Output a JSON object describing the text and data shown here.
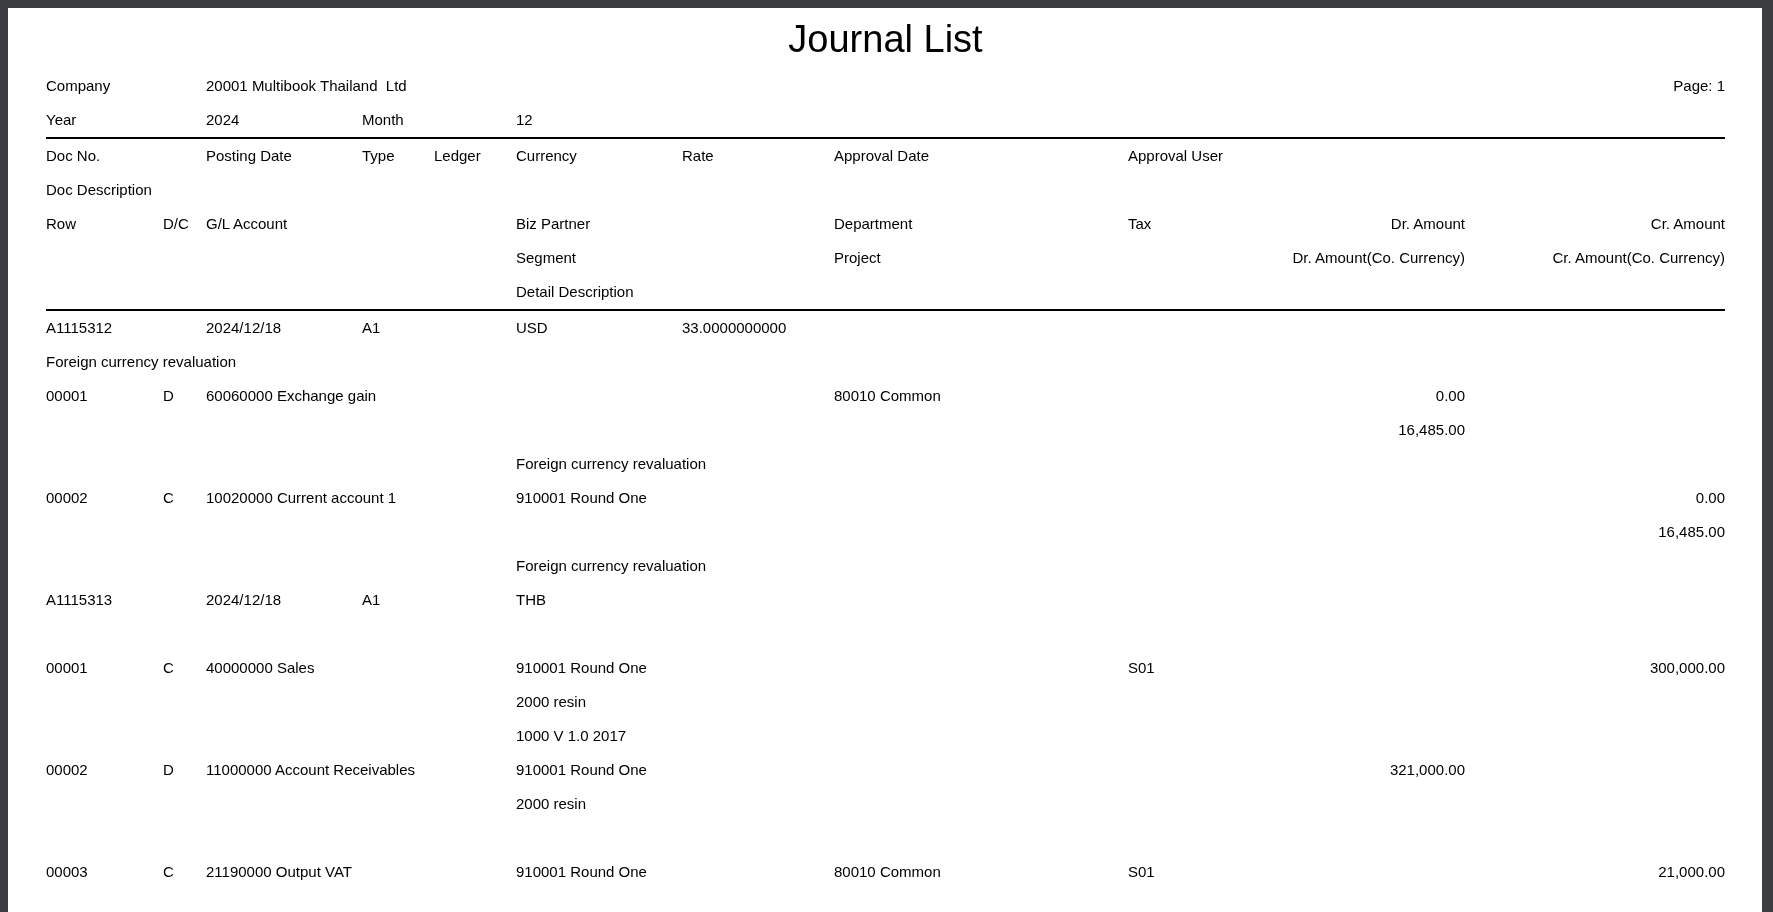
{
  "title": "Journal List",
  "page": "Page: 1",
  "header": {
    "company_label": "Company",
    "company": "20001 Multibook Thailand  Ltd",
    "year_label": "Year",
    "year": "2024",
    "month_label": "Month",
    "month": "12"
  },
  "headings": {
    "doc_no": "Doc No.",
    "posting_date": "Posting Date",
    "type": "Type",
    "ledger": "Ledger",
    "currency": "Currency",
    "rate": "Rate",
    "approval_date": "Approval Date",
    "approval_user": "Approval User",
    "doc_description": "Doc Description",
    "row": "Row",
    "dc": "D/C",
    "gl_account": "G/L Account",
    "biz_partner": "Biz Partner",
    "department": "Department",
    "tax": "Tax",
    "dr_amount": "Dr. Amount",
    "cr_amount": "Cr. Amount",
    "segment": "Segment",
    "project": "Project",
    "dr_amount_co": "Dr. Amount(Co. Currency)",
    "cr_amount_co": "Cr. Amount(Co. Currency)",
    "detail_description": "Detail Description"
  },
  "documents": [
    {
      "doc_no": "A1115312",
      "posting_date": "2024/12/18",
      "type": "A1",
      "currency": "USD",
      "rate": "33.0000000000",
      "doc_description": "Foreign currency revaluation",
      "rows": [
        {
          "row": "00001",
          "dc": "D",
          "gl_account": "60060000 Exchange gain",
          "department": "80010 Common",
          "dr_amount": "0.00",
          "dr_amount_co": "16,485.00",
          "detail_description": "Foreign currency revaluation"
        },
        {
          "row": "00002",
          "dc": "C",
          "gl_account": "10020000 Current account 1",
          "biz_partner": "910001 Round One",
          "cr_amount": "0.00",
          "cr_amount_co": "16,485.00",
          "detail_description": "Foreign currency revaluation"
        }
      ]
    },
    {
      "doc_no": "A1115313",
      "posting_date": "2024/12/18",
      "type": "A1",
      "currency": "THB",
      "rows": [
        {
          "row": "00001",
          "dc": "C",
          "gl_account": "40000000 Sales",
          "biz_partner": "910001 Round One",
          "tax": "S01",
          "cr_amount": "300,000.00",
          "segment": "2000 resin",
          "detail_description": "1000 V 1.0 2017"
        },
        {
          "row": "00002",
          "dc": "D",
          "gl_account": "11000000 Account Receivables",
          "biz_partner": "910001 Round One",
          "dr_amount": "321,000.00",
          "segment": "2000 resin"
        },
        {
          "row": "00003",
          "dc": "C",
          "gl_account": "21190000 Output VAT",
          "biz_partner": "910001 Round One",
          "department": "80010 Common",
          "tax": "S01",
          "cr_amount": "21,000.00"
        }
      ]
    }
  ]
}
